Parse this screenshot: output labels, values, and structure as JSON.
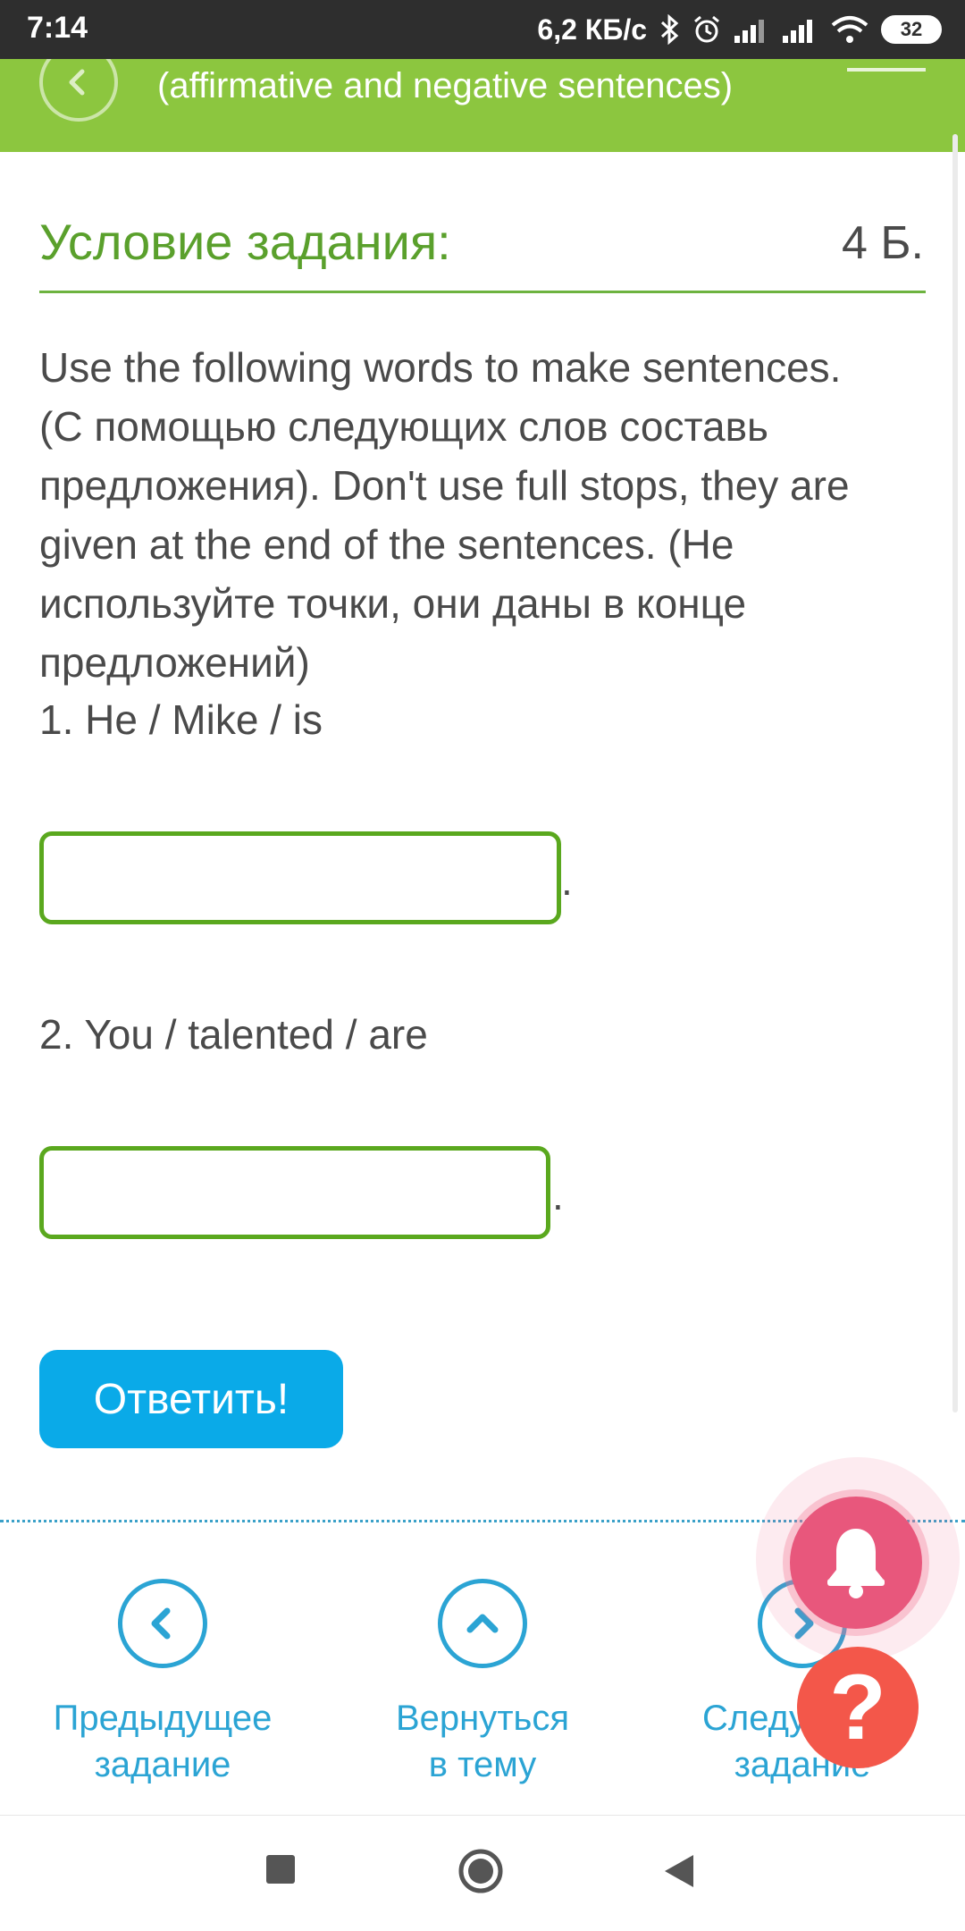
{
  "status_bar": {
    "time": "7:14",
    "network_speed": "6,2 КБ/с",
    "battery": "32"
  },
  "header": {
    "title": "(affirmative and negative sentences)"
  },
  "condition": {
    "title": "Условие задания:",
    "points": "4 Б."
  },
  "instructions": {
    "line1": "Use the following words to make sentences.",
    "line2": "(С помощью следующих слов составь предложения). Don't use full stops, they are given at the end of the sentences. (Не используйте точки, они даны в конце предложений)"
  },
  "questions": [
    {
      "label": "1. He / Mike / is",
      "value": "",
      "suffix": "."
    },
    {
      "label": "2. You / talented / are",
      "value": "",
      "suffix": "."
    }
  ],
  "submit_label": "Ответить!",
  "bottom_nav": {
    "prev_line1": "Предыдущее",
    "prev_line2": "задание",
    "back_line1": "Вернуться",
    "back_line2": "в тему",
    "next_line1": "Следующее",
    "next_line2": "задание"
  },
  "help_label": "?",
  "colors": {
    "header_green": "#8cc63f",
    "title_green": "#5aa02c",
    "input_border": "#5aa81e",
    "submit_blue": "#0aaae8",
    "nav_blue": "#2ba4d4",
    "bell_pink": "#e8577c",
    "help_red": "#f3574a"
  }
}
